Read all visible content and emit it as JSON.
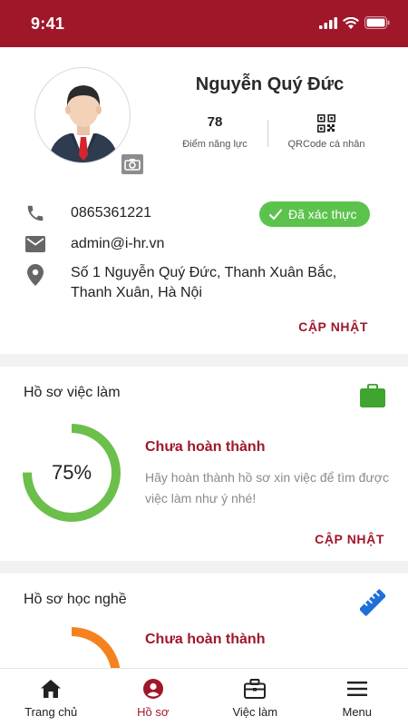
{
  "status_bar": {
    "time": "9:41"
  },
  "profile": {
    "name": "Nguyễn Quý Đức",
    "score_value": "78",
    "score_label": "Điểm năng lực",
    "qr_label": "QRCode cá nhân",
    "phone": "0865361221",
    "verified_label": "Đã xác thực",
    "email": "admin@i-hr.vn",
    "address": "Số 1 Nguyễn Quý Đức, Thanh Xuân Bắc, Thanh Xuân, Hà Nội",
    "update_label": "CẬP NHẬT"
  },
  "job_profile": {
    "title": "Hồ sơ việc làm",
    "progress": 75,
    "progress_label": "75%",
    "status": "Chưa hoàn thành",
    "description": "Hãy hoàn thành hồ sơ xin việc để tìm được việc làm như ý nhé!",
    "update_label": "CẬP NHẬT",
    "color": "#6cbf4a"
  },
  "vocational_profile": {
    "title": "Hồ sơ học nghề",
    "status": "Chưa hoàn thành",
    "color": "#f5821f"
  },
  "bottom_nav": [
    {
      "label": "Trang chủ",
      "icon": "home-icon",
      "active": false
    },
    {
      "label": "Hồ sơ",
      "icon": "user-circle-icon",
      "active": true
    },
    {
      "label": "Việc làm",
      "icon": "briefcase-icon",
      "active": false
    },
    {
      "label": "Menu",
      "icon": "menu-icon",
      "active": false
    }
  ],
  "colors": {
    "brand": "#a0172a",
    "verified": "#5bc34c",
    "icon_gray": "#666666"
  }
}
